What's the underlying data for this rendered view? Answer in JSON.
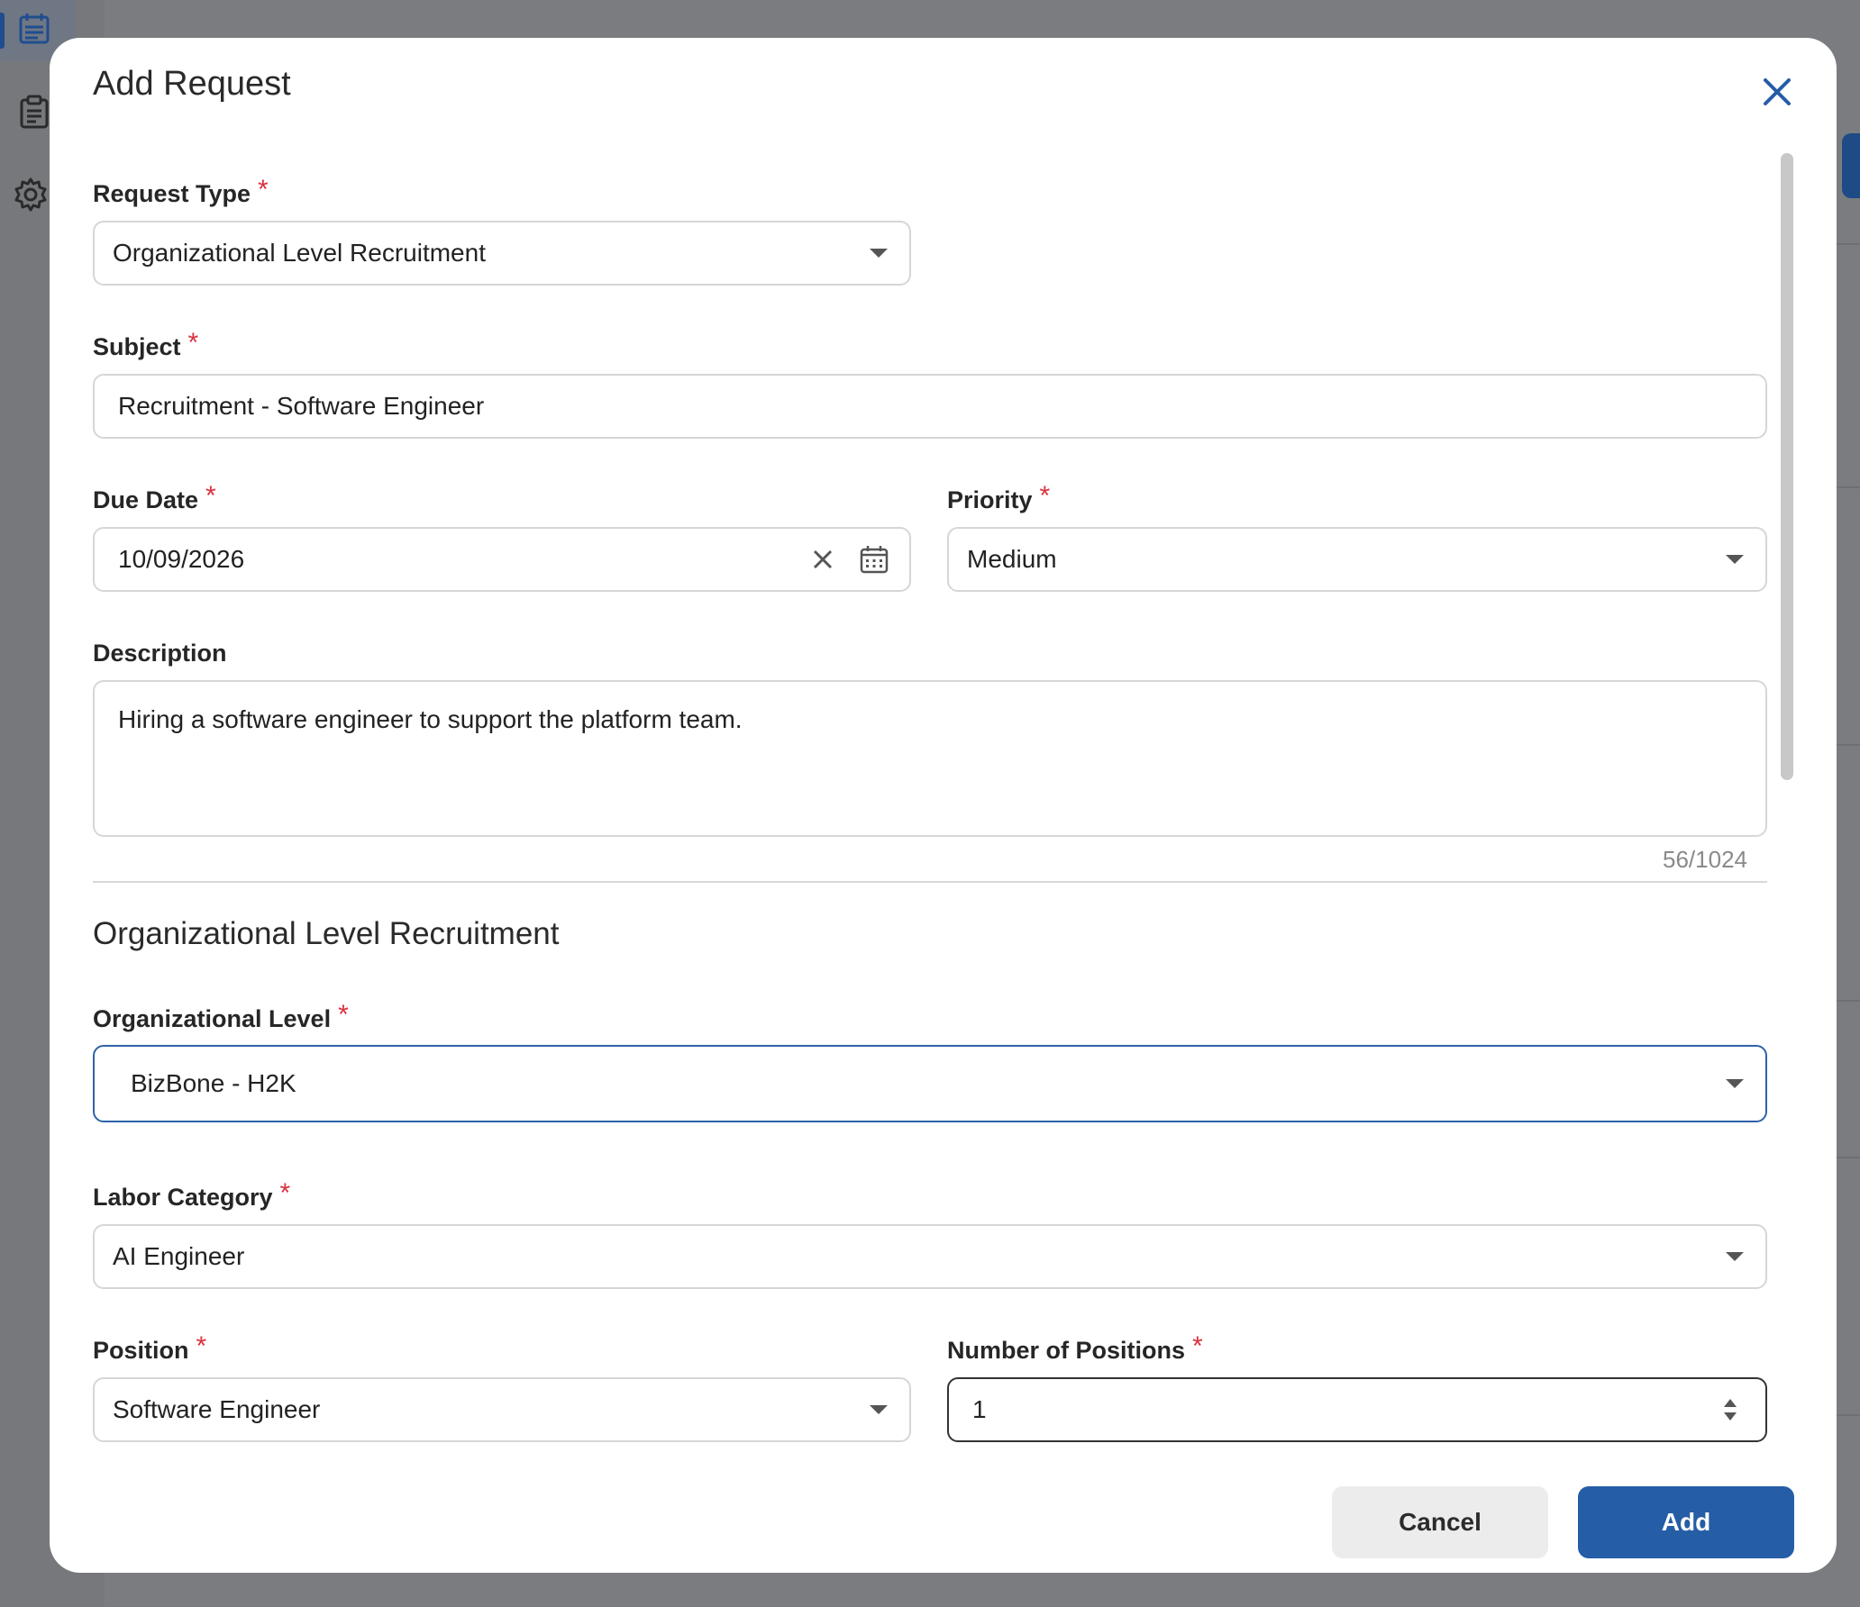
{
  "modal": {
    "title": "Add Request",
    "close_icon": "close-icon"
  },
  "form": {
    "request_type": {
      "label": "Request Type",
      "value": "Organizational Level Recruitment",
      "required": "*"
    },
    "subject": {
      "label": "Subject",
      "value": "Recruitment - Software Engineer",
      "required": "*"
    },
    "due_date": {
      "label": "Due Date",
      "value": "10/09/2026",
      "required": "*"
    },
    "priority": {
      "label": "Priority",
      "value": "Medium",
      "required": "*"
    },
    "description": {
      "label": "Description",
      "value": "Hiring a software engineer to support the platform team.",
      "counter": "56/1024"
    }
  },
  "section": {
    "title": "Organizational Level Recruitment",
    "organizational_level": {
      "label": "Organizational Level",
      "value": "BizBone - H2K",
      "required": "*"
    },
    "labor_category": {
      "label": "Labor Category",
      "value": "AI Engineer",
      "required": "*"
    },
    "position": {
      "label": "Position",
      "value": "Software Engineer",
      "required": "*"
    },
    "number_of_positions": {
      "label": "Number of Positions",
      "value": "1",
      "required": "*"
    }
  },
  "footer": {
    "cancel_label": "Cancel",
    "add_label": "Add"
  },
  "colors": {
    "primary": "#255da6",
    "required": "#d9323f",
    "focus_border": "#2f62a8"
  }
}
